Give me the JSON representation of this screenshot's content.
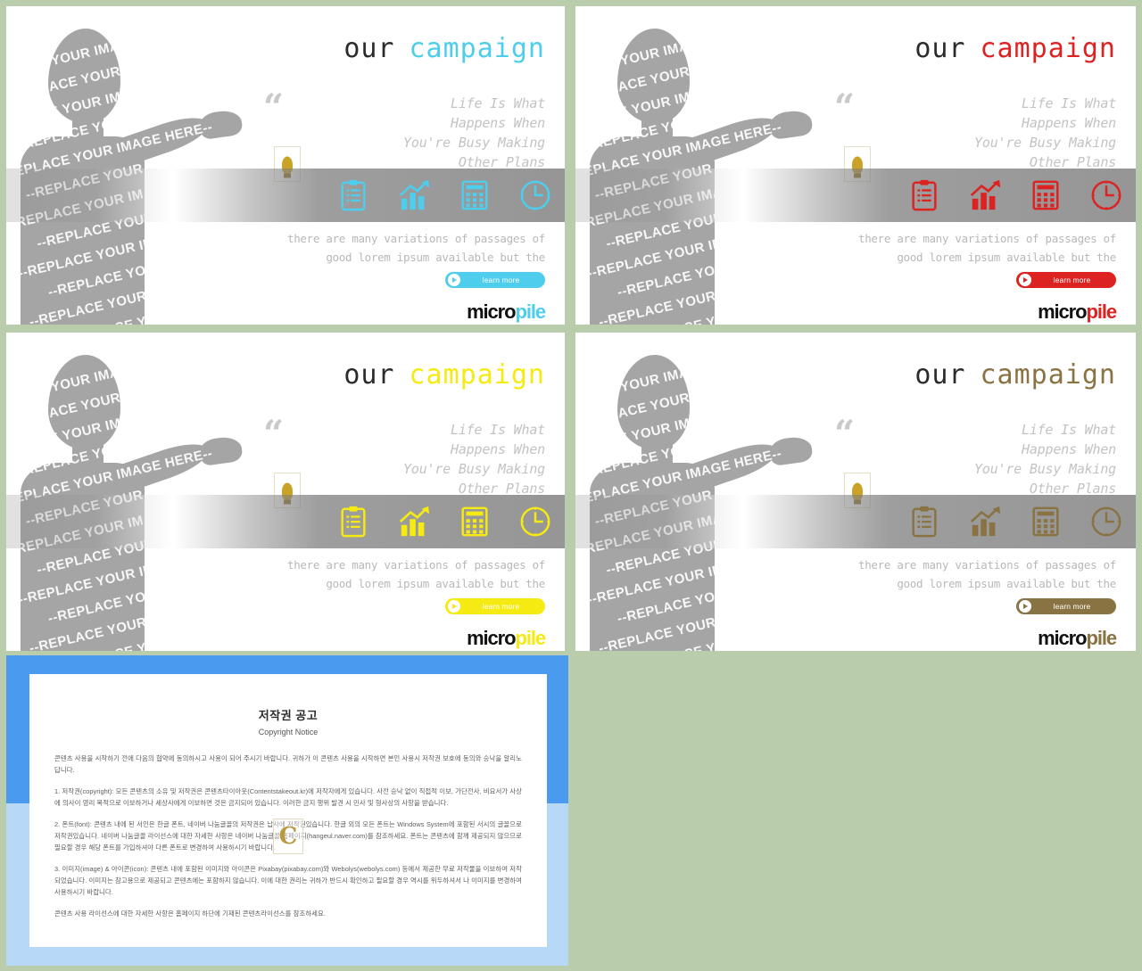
{
  "page": {
    "background_color": "#b9ccab"
  },
  "slides": [
    {
      "id": "slide-cyan",
      "accent": "#4ecdec",
      "accent_dark": "#35bcdd",
      "title_word1": "our",
      "title_word2": "campaign",
      "quote_mark": "“",
      "quote_lines": [
        "Life Is What",
        "Happens When",
        "You're Busy Making",
        "Other Plans"
      ],
      "icons": [
        "clipboard-icon",
        "bar-chart-icon",
        "calculator-icon",
        "clock-icon"
      ],
      "body_lines": [
        "there are many variations of passages of",
        "good lorem ipsum available but the"
      ],
      "button_label": "learn more",
      "logo_part1": "micro",
      "logo_part2": "pile",
      "watermark_text": "--REPLACE YOUR IMAGE HERE--"
    },
    {
      "id": "slide-red",
      "accent": "#dd2222",
      "accent_dark": "#c41616",
      "title_word1": "our",
      "title_word2": "campaign",
      "quote_mark": "“",
      "quote_lines": [
        "Life Is What",
        "Happens When",
        "You're Busy Making",
        "Other Plans"
      ],
      "icons": [
        "clipboard-icon",
        "bar-chart-icon",
        "calculator-icon",
        "clock-icon"
      ],
      "body_lines": [
        "there are many variations of passages of",
        "good lorem ipsum available but the"
      ],
      "button_label": "learn more",
      "logo_part1": "micro",
      "logo_part2": "pile",
      "watermark_text": "--REPLACE YOUR IMAGE HERE--"
    },
    {
      "id": "slide-yellow",
      "accent": "#f5ea12",
      "accent_dark": "#e8dc00",
      "title_word1": "our",
      "title_word2": "campaign",
      "quote_mark": "“",
      "quote_lines": [
        "Life Is What",
        "Happens When",
        "You're Busy Making",
        "Other Plans"
      ],
      "icons": [
        "clipboard-icon",
        "bar-chart-icon",
        "calculator-icon",
        "clock-icon"
      ],
      "body_lines": [
        "there are many variations of passages of",
        "good lorem ipsum available but the"
      ],
      "button_label": "learn more",
      "logo_part1": "micro",
      "logo_part2": "pile",
      "watermark_text": "--REPLACE YOUR IMAGE HERE--"
    },
    {
      "id": "slide-brown",
      "accent": "#8a7342",
      "accent_dark": "#6f5c33",
      "title_word1": "our",
      "title_word2": "campaign",
      "quote_mark": "“",
      "quote_lines": [
        "Life Is What",
        "Happens When",
        "You're Busy Making",
        "Other Plans"
      ],
      "icons": [
        "clipboard-icon",
        "bar-chart-icon",
        "calculator-icon",
        "clock-icon"
      ],
      "body_lines": [
        "there are many variations of passages of",
        "good lorem ipsum available but the"
      ],
      "button_label": "learn more",
      "logo_part1": "micro",
      "logo_part2": "pile",
      "watermark_text": "--REPLACE YOUR IMAGE HERE--"
    }
  ],
  "notice": {
    "frame_color_top": "#4a9bf0",
    "frame_color_bottom": "#b7d9f7",
    "title_kr": "저작권 공고",
    "title_en": "Copyright Notice",
    "watermark_letter": "C",
    "paragraphs": [
      "콘텐츠 사용을 시작하기 전에 다음의 협약에 동의하시고 사용이 되어 주시기 바랍니다. 귀하가 이 콘텐츠 사용을 시작하면 본인 사용시 저작권 보호에 동의와 승낙을 알리노답니다.",
      "1. 저작권(copyright): 모든 콘텐츠의 소유 및 저작권은 콘텐츠타이아웃(Contentstakeout.kr)에 저작자에게 있습니다. 사전 승낙 없이 직접적 이보, 가단전사, 비요서가 사상에 의사이 영리 목적으로 이보하거나 세상사에게 이보하면 것은 금지되어 있습니다. 이러한 금지 행위 발견 시 민사 및 형사상의 사항을 받습니다.",
      "2. 폰트(font): 콘텐츠 내에 된 서인은 한글 폰트, 네이버 나눔글꼴의 저작권은 납사에 저작권있습니다. 한글 외의 모든 폰트는 Windows System에 포함된 서시의 글꼴으로 저작권있습니다. 네이버 나눔글꼴 라이선스에 대한 자세한 사항은 네이버 나눔글꼴 홈페이지(hangeul.naver.com)를 참조하세요. 폰트는 콘텐츠에 함께 제공되지 않으므로 필요할 경우 해당 폰트를 가입하셔야 다른 폰트로 변경하여 사용하시기 바랍니다.",
      "3. 이미지(image) & 아이콘(icon): 콘텐츠 내에 포함된 이미지와 아이콘은 Pixabay(pixabay.com)와 Webolys(webolys.com) 등에서 제공한 무료 저작물을 이보하여 저작되었습니다. 이미지는 참고용으로 제공되고 콘텐츠에는 포함하지 않습니다. 이에 대한 권리는 귀하가 반드시 확인하고 필요할 경우 역시를 위두하셔서 나 이미지를 변경하여 사용하시기 바랍니다.",
      "콘텐츠 사용 라이선스에 대한 자세한 사항은 홈페이지 하단에 기재된 콘텐츠라이선스를 참조하세요."
    ]
  }
}
